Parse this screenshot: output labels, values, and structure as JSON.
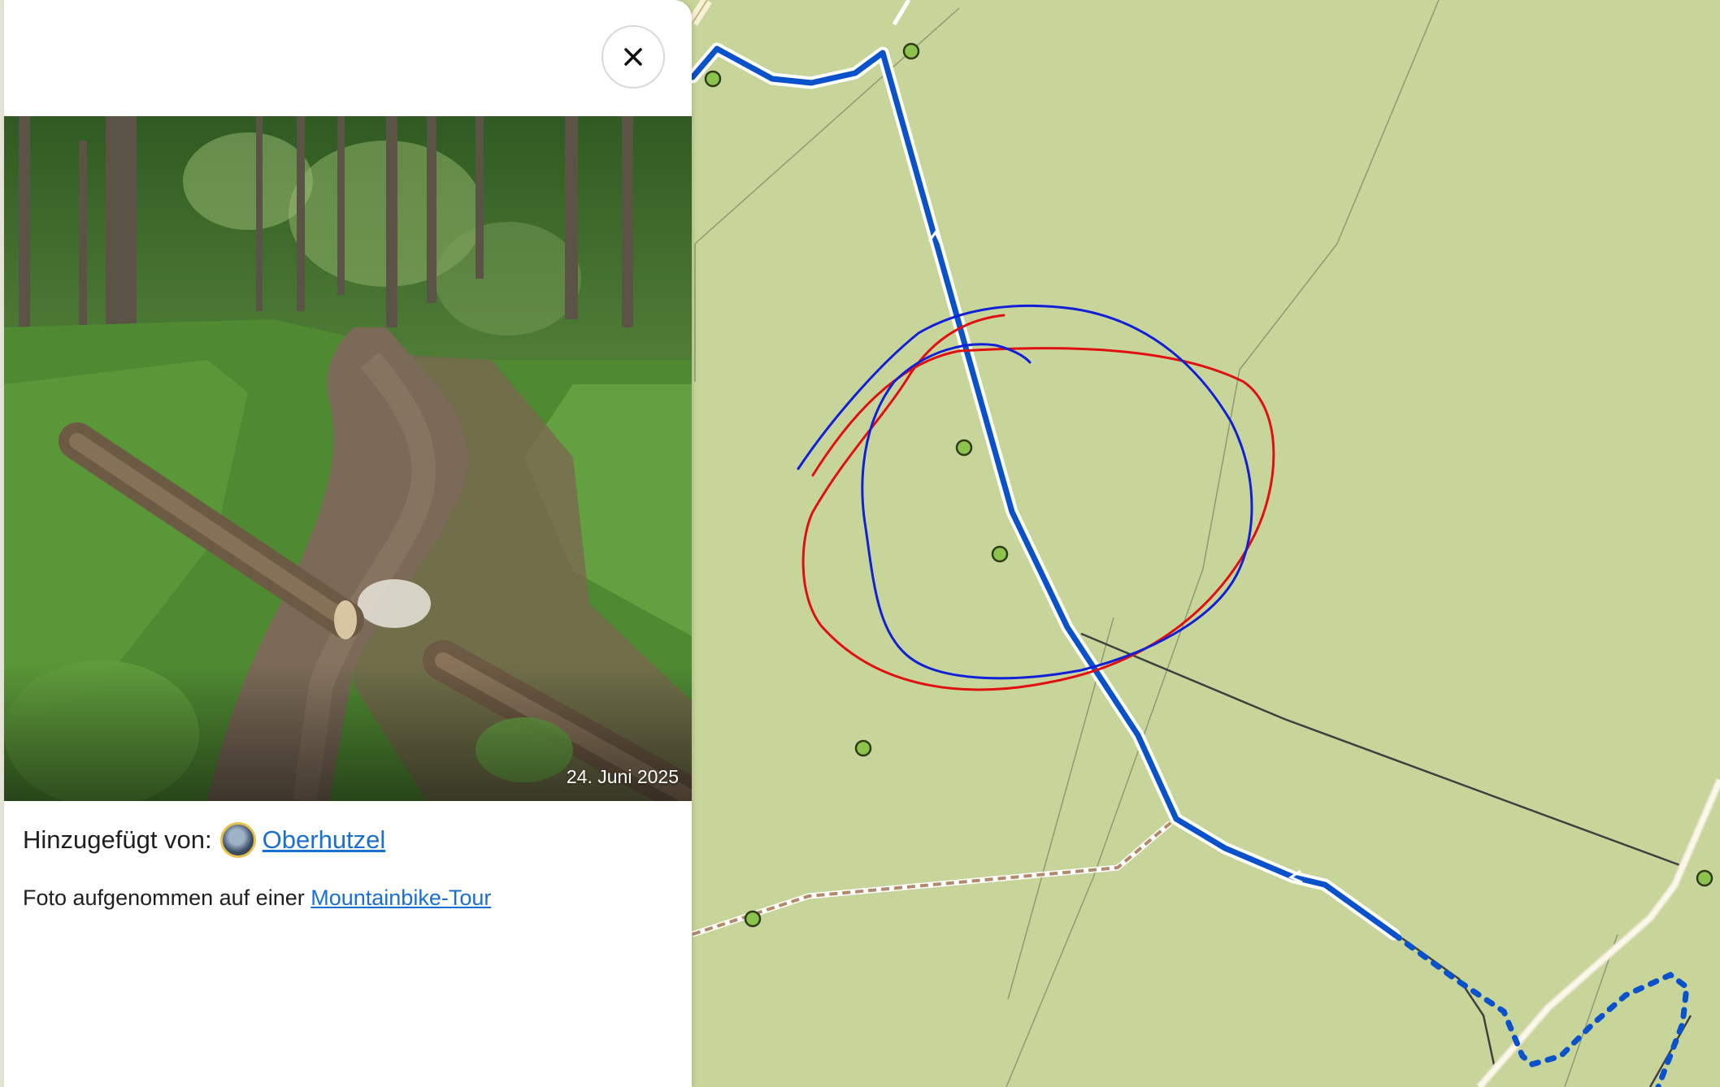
{
  "panel": {
    "close_icon": "close-icon",
    "photo": {
      "date": "24. Juni 2025"
    },
    "added_by_label": "Hinzugefügt von:",
    "author_name": "Oberhutzel",
    "photo_caption_prefix": "Foto aufgenommen auf einer",
    "tour_link": "Mountainbike-Tour"
  },
  "map": {
    "route_color": "#0a52cc",
    "annotation_colors": [
      "#e01010",
      "#1020d8"
    ],
    "poi_color": "#8cc34a"
  }
}
